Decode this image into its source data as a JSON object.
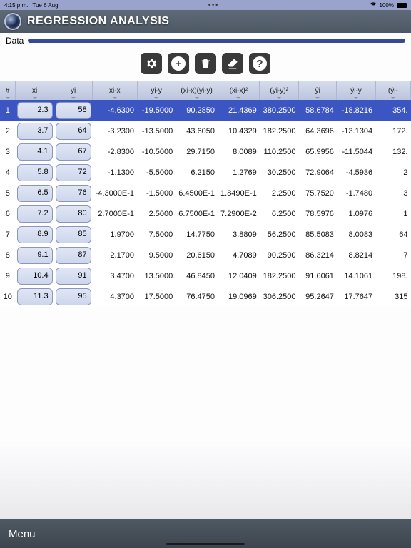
{
  "status": {
    "time": "4:15 p.m.",
    "date": "Tue 6 Aug",
    "wifi": "wifi-icon",
    "battery_pct": "100%"
  },
  "app": {
    "title": "REGRESSION ANALYSIS"
  },
  "section": {
    "label": "Data"
  },
  "toolbar": {
    "settings": "settings",
    "add": "add",
    "delete": "delete",
    "clear": "clear",
    "help": "help"
  },
  "headers": [
    "#",
    "xi",
    "yi",
    "xi-x̄",
    "yi-ȳ",
    "(xi-x̄)(yi-ȳ)",
    "(xi-x̄)²",
    "(yi-ȳ)²",
    "ŷi",
    "ŷi-ȳ",
    "(ŷi-"
  ],
  "rows": [
    {
      "idx": "1",
      "xi": "2.3",
      "yi": "58",
      "c": [
        "-4.6300",
        "-19.5000",
        "90.2850",
        "21.4369",
        "380.2500",
        "58.6784",
        "-18.8216",
        "354."
      ]
    },
    {
      "idx": "2",
      "xi": "3.7",
      "yi": "64",
      "c": [
        "-3.2300",
        "-13.5000",
        "43.6050",
        "10.4329",
        "182.2500",
        "64.3696",
        "-13.1304",
        "172."
      ]
    },
    {
      "idx": "3",
      "xi": "4.1",
      "yi": "67",
      "c": [
        "-2.8300",
        "-10.5000",
        "29.7150",
        "8.0089",
        "110.2500",
        "65.9956",
        "-11.5044",
        "132."
      ]
    },
    {
      "idx": "4",
      "xi": "5.8",
      "yi": "72",
      "c": [
        "-1.1300",
        "-5.5000",
        "6.2150",
        "1.2769",
        "30.2500",
        "72.9064",
        "-4.5936",
        "2"
      ]
    },
    {
      "idx": "5",
      "xi": "6.5",
      "yi": "76",
      "c": [
        "-4.3000E-1",
        "-1.5000",
        "6.4500E-1",
        "1.8490E-1",
        "2.2500",
        "75.7520",
        "-1.7480",
        "3"
      ]
    },
    {
      "idx": "6",
      "xi": "7.2",
      "yi": "80",
      "c": [
        "2.7000E-1",
        "2.5000",
        "6.7500E-1",
        "7.2900E-2",
        "6.2500",
        "78.5976",
        "1.0976",
        "1"
      ]
    },
    {
      "idx": "7",
      "xi": "8.9",
      "yi": "85",
      "c": [
        "1.9700",
        "7.5000",
        "14.7750",
        "3.8809",
        "56.2500",
        "85.5083",
        "8.0083",
        "64"
      ]
    },
    {
      "idx": "8",
      "xi": "9.1",
      "yi": "87",
      "c": [
        "2.1700",
        "9.5000",
        "20.6150",
        "4.7089",
        "90.2500",
        "86.3214",
        "8.8214",
        "7"
      ]
    },
    {
      "idx": "9",
      "xi": "10.4",
      "yi": "91",
      "c": [
        "3.4700",
        "13.5000",
        "46.8450",
        "12.0409",
        "182.2500",
        "91.6061",
        "14.1061",
        "198."
      ]
    },
    {
      "idx": "10",
      "xi": "11.3",
      "yi": "95",
      "c": [
        "4.3700",
        "17.5000",
        "76.4750",
        "19.0969",
        "306.2500",
        "95.2647",
        "17.7647",
        "315"
      ]
    }
  ],
  "selected_row": 0,
  "menu_label": "Menu"
}
